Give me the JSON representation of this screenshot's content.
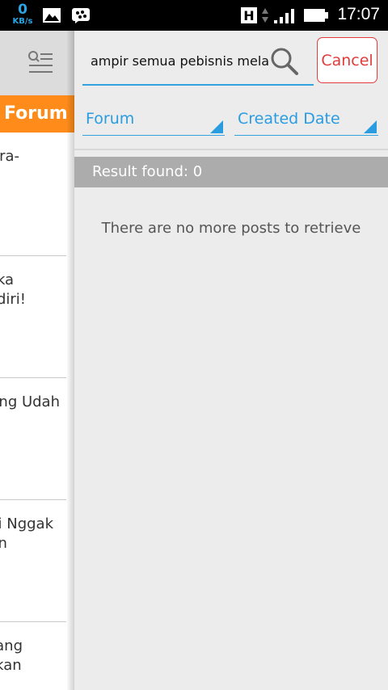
{
  "status_bar": {
    "data_rate_value": "0",
    "data_rate_unit": "KB/s",
    "network_type": "H",
    "time": "17:07"
  },
  "background_panel": {
    "header_text": "Forum R",
    "items": [
      "ra-",
      "ka\ndiri!",
      "ang Udah",
      "i Nggak\nn",
      "ang\nkan"
    ]
  },
  "search": {
    "value": "ampir semua pebisnis melalui c",
    "cancel_label": "Cancel"
  },
  "filters": {
    "forum_label": "Forum",
    "date_label": "Created Date"
  },
  "results": {
    "summary": "Result found: 0",
    "empty_message": "There are no more posts to retrieve"
  },
  "colors": {
    "accent_blue": "#2a9ce0",
    "cancel_red": "#e03c3c",
    "header_orange": "#ff8c1a"
  }
}
